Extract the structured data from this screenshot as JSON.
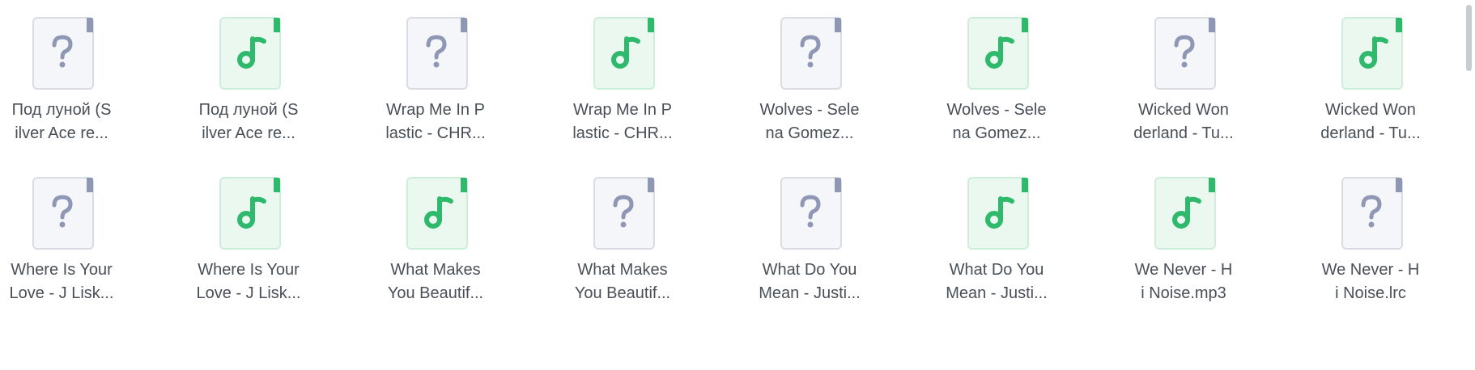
{
  "files": [
    {
      "name": "Под луной (S\nilver Ace re...",
      "type": "unknown"
    },
    {
      "name": "Под луной (S\nilver Ace re...",
      "type": "audio"
    },
    {
      "name": "Wrap Me In P\nlastic - CHR...",
      "type": "unknown"
    },
    {
      "name": "Wrap Me In P\nlastic - CHR...",
      "type": "audio"
    },
    {
      "name": "Wolves - Sele\nna Gomez...",
      "type": "unknown"
    },
    {
      "name": "Wolves - Sele\nna Gomez...",
      "type": "audio"
    },
    {
      "name": "Wicked Won\nderland - Tu...",
      "type": "unknown"
    },
    {
      "name": "Wicked Won\nderland - Tu...",
      "type": "audio"
    },
    {
      "name": "Where Is Your\nLove - J Lisk...",
      "type": "unknown"
    },
    {
      "name": "Where Is Your\nLove - J Lisk...",
      "type": "audio"
    },
    {
      "name": "What Makes\nYou Beautif...",
      "type": "audio"
    },
    {
      "name": "What Makes\nYou Beautif...",
      "type": "unknown"
    },
    {
      "name": "What Do You\nMean - Justi...",
      "type": "unknown"
    },
    {
      "name": "What Do You\nMean - Justi...",
      "type": "audio"
    },
    {
      "name": "We Never - H\ni Noise.mp3",
      "type": "audio"
    },
    {
      "name": "We Never - H\ni Noise.lrc",
      "type": "unknown"
    }
  ],
  "icons": {
    "audio": "music-file-icon",
    "unknown": "unknown-file-icon"
  },
  "colors": {
    "audio_bg": "#eaf8f0",
    "audio_border": "#cdeedb",
    "audio_accent": "#2fb96c",
    "unknown_bg": "#f5f6fa",
    "unknown_border": "#d9dce3",
    "unknown_accent": "#8e98b4",
    "text": "#4a4f57"
  }
}
